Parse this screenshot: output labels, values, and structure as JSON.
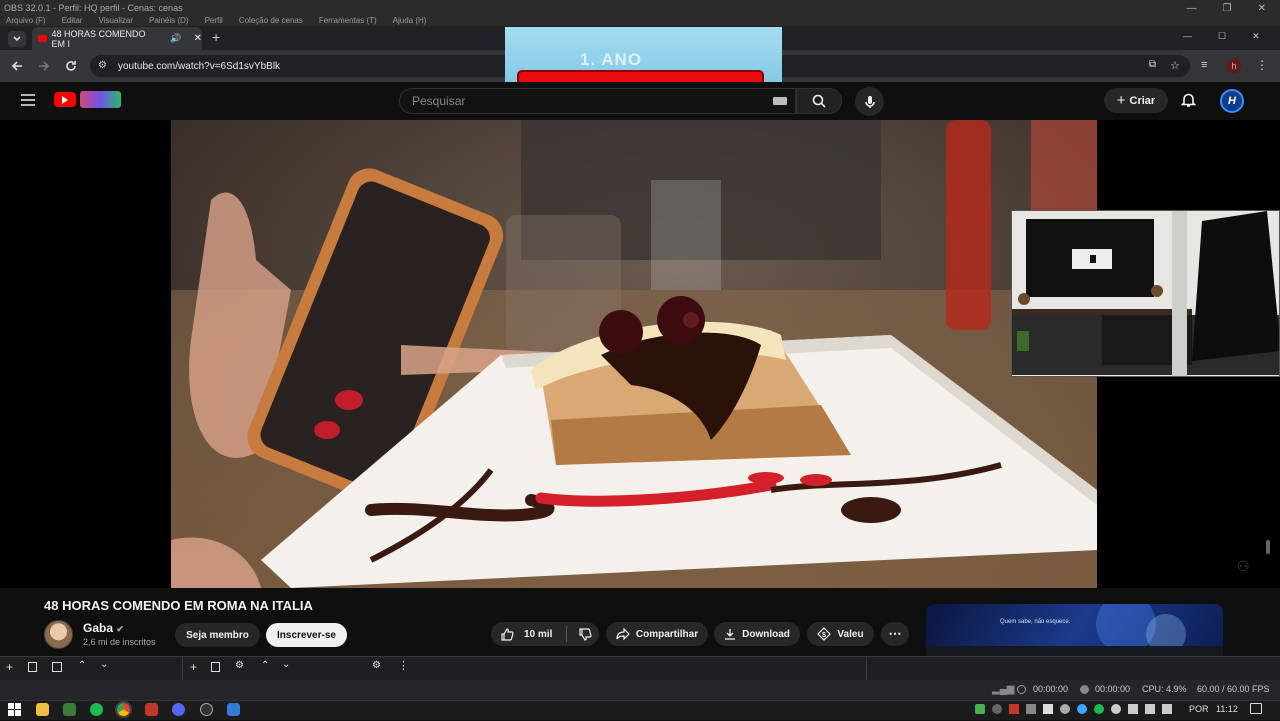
{
  "obs": {
    "title": "OBS 32.0.1 - Perfil: HQ perfil - Cenas: cenas",
    "menu": [
      "Arquivo (F)",
      "Editar",
      "Visualizar",
      "Painéis (D)",
      "Perfil",
      "Coleção de cenas",
      "Ferramentas (T)",
      "Ajuda (H)"
    ],
    "status": {
      "rec_time": "00:00:00",
      "stream_time": "00:00:00",
      "cpu": "CPU: 4.9%",
      "fps": "60.00 / 60.00 FPS"
    }
  },
  "browser": {
    "tab_title": "48 HORAS COMENDO EM I",
    "url": "youtube.com/watch?v=6Sd1svYbBlk"
  },
  "overlay": {
    "banner_text": "1. ANO"
  },
  "youtube": {
    "search_placeholder": "Pesquisar",
    "create_label": "Criar",
    "account_initial": "H",
    "video_title": "48 HORAS COMENDO EM ROMA NA ITALIA",
    "channel_name": "Gaba",
    "channel_subs": "2,6 mi de inscritos",
    "member_label": "Seja membro",
    "subscribe_label": "Inscrever-se",
    "likes": "10 mil",
    "share_label": "Compartilhar",
    "download_label": "Download",
    "thanks_label": "Valeu",
    "side_card_text": "Quem sabe, não esquece."
  },
  "taskbar": {
    "language": "POR",
    "time": "11:12"
  },
  "colors": {
    "youtube_red": "#ff0000",
    "overlay_bar": "#e80c0c",
    "overlay_bg": "#a6dcef"
  }
}
